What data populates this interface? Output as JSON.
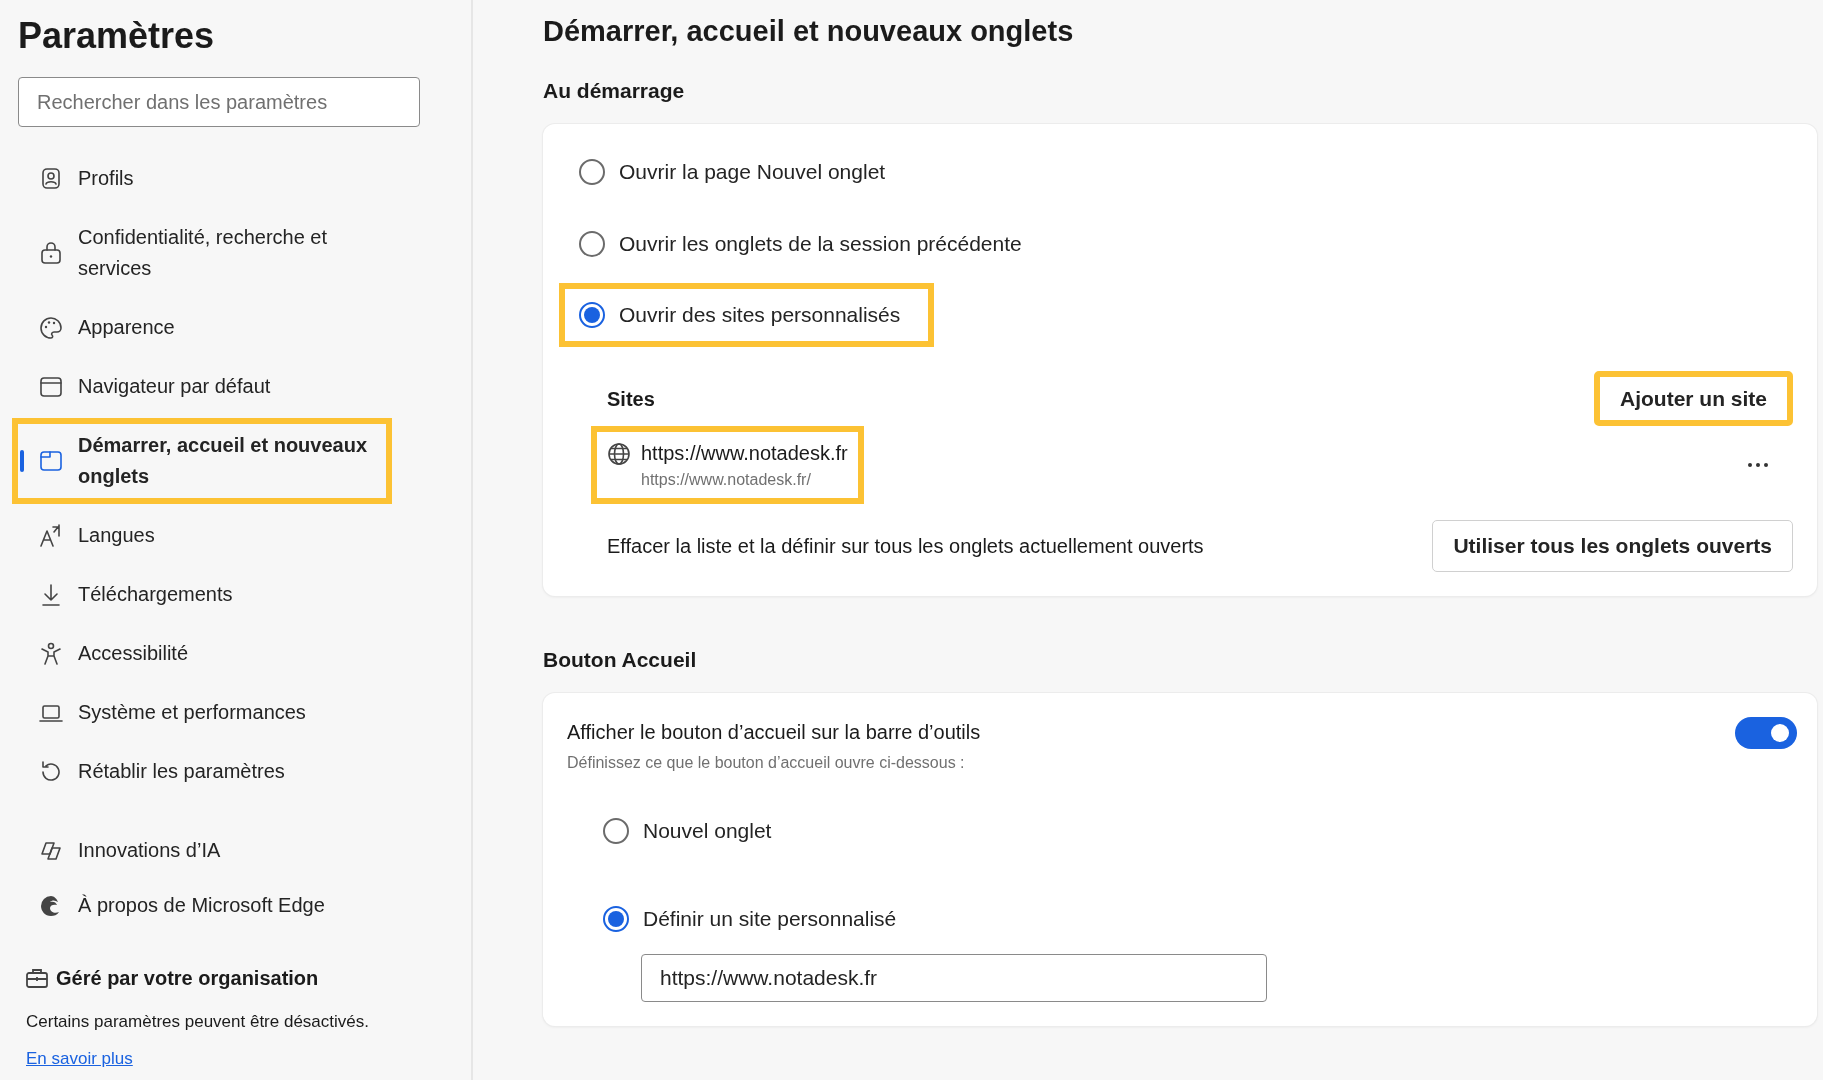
{
  "sidebar": {
    "title": "Paramètres",
    "search": {
      "placeholder": "Rechercher dans les paramètres"
    },
    "groups": [
      [
        {
          "label": "Profils",
          "kind": "profile",
          "selected": false,
          "highlighted": false
        },
        {
          "label": "Confidentialité, recherche et services",
          "kind": "privacy",
          "selected": false,
          "highlighted": false
        },
        {
          "label": "Apparence",
          "kind": "appearance",
          "selected": false,
          "highlighted": false
        },
        {
          "label": "Navigateur par défaut",
          "kind": "browser",
          "selected": false,
          "highlighted": false
        },
        {
          "label": "Démarrer, accueil et nouveaux onglets",
          "kind": "start",
          "selected": true,
          "highlighted": true
        },
        {
          "label": "Langues",
          "kind": "languages",
          "selected": false,
          "highlighted": false
        },
        {
          "label": "Téléchargements",
          "kind": "downloads",
          "selected": false,
          "highlighted": false
        },
        {
          "label": "Accessibilité",
          "kind": "accessibility",
          "selected": false,
          "highlighted": false
        },
        {
          "label": "Système et performances",
          "kind": "system",
          "selected": false,
          "highlighted": false
        },
        {
          "label": "Rétablir les paramètres",
          "kind": "reset",
          "selected": false,
          "highlighted": false
        }
      ],
      [
        {
          "label": "Innovations d’IA",
          "kind": "ai",
          "selected": false,
          "highlighted": false
        },
        {
          "label": "À propos de Microsoft Edge",
          "kind": "about",
          "selected": false,
          "highlighted": false
        }
      ]
    ],
    "footer": {
      "title": "Géré par votre organisation",
      "text": "Certains paramètres peuvent être désactivés.",
      "link": "En savoir plus"
    }
  },
  "main": {
    "title": "Démarrer, accueil et nouveaux onglets",
    "startup": {
      "heading": "Au démarrage",
      "options": [
        {
          "label": "Ouvrir la page Nouvel onglet",
          "selected": false,
          "highlighted": false
        },
        {
          "label": "Ouvrir les onglets de la session précédente",
          "selected": false,
          "highlighted": false
        },
        {
          "label": "Ouvrir des sites personnalisés",
          "selected": true,
          "highlighted": true
        }
      ],
      "sites": {
        "heading": "Sites",
        "add_button": {
          "label": "Ajouter un site",
          "highlighted": true
        },
        "items": [
          {
            "title": "https://www.notadesk.fr",
            "url": "https://www.notadesk.fr/",
            "highlighted": true
          }
        ],
        "clear_text": "Effacer la liste et la définir sur tous les onglets actuellement ouverts",
        "use_all_button": "Utiliser tous les onglets ouverts"
      }
    },
    "home": {
      "heading": "Bouton Accueil",
      "toggle": {
        "label": "Afficher le bouton d’accueil sur la barre d’outils",
        "hint": "Définissez ce que le bouton d’accueil ouvre ci-dessous :",
        "on": true
      },
      "options": [
        {
          "label": "Nouvel onglet",
          "selected": false
        },
        {
          "label": "Définir un site personnalisé",
          "selected": true
        }
      ],
      "custom_url": {
        "value": "https://www.notadesk.fr"
      }
    }
  }
}
